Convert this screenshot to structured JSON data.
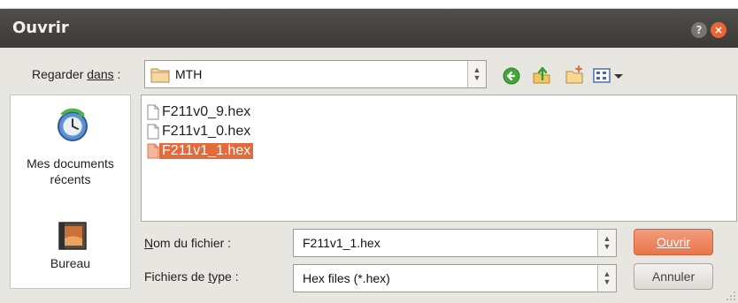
{
  "dialog": {
    "title": "Ouvrir",
    "help_icon": "help-icon",
    "close_icon": "close-icon"
  },
  "lookin": {
    "label_prefix": "Regarder ",
    "label_underline": "dans",
    "label_suffix": " :",
    "value": "MTH",
    "folder_icon": "folder-icon"
  },
  "toolbar": {
    "back_icon": "back-arrow-icon",
    "up_icon": "up-folder-icon",
    "new_folder_icon": "new-folder-icon",
    "view_menu_icon": "view-menu-icon"
  },
  "places": [
    {
      "label_line1": "Mes documents",
      "label_line2": "récents",
      "icon": "recent-documents-icon"
    },
    {
      "label_line1": "Bureau",
      "icon": "desktop-icon"
    }
  ],
  "files": [
    {
      "name": "F211v0_9.hex",
      "selected": false
    },
    {
      "name": "F211v1_0.hex",
      "selected": false
    },
    {
      "name": "F211v1_1.hex",
      "selected": true
    }
  ],
  "filename": {
    "label_underline": "N",
    "label_rest": "om du fichier :",
    "value": "F211v1_1.hex"
  },
  "filetype": {
    "label_prefix": "Fichiers de ",
    "label_underline": "t",
    "label_rest": "ype :",
    "value": "Hex files (*.hex)"
  },
  "buttons": {
    "open_label": "Ouvrir",
    "cancel_label": "Annuler"
  },
  "colors": {
    "accent": "#e36a3c",
    "titlebar": "#3f3e3b",
    "dialog_bg": "#e8e6e1"
  }
}
